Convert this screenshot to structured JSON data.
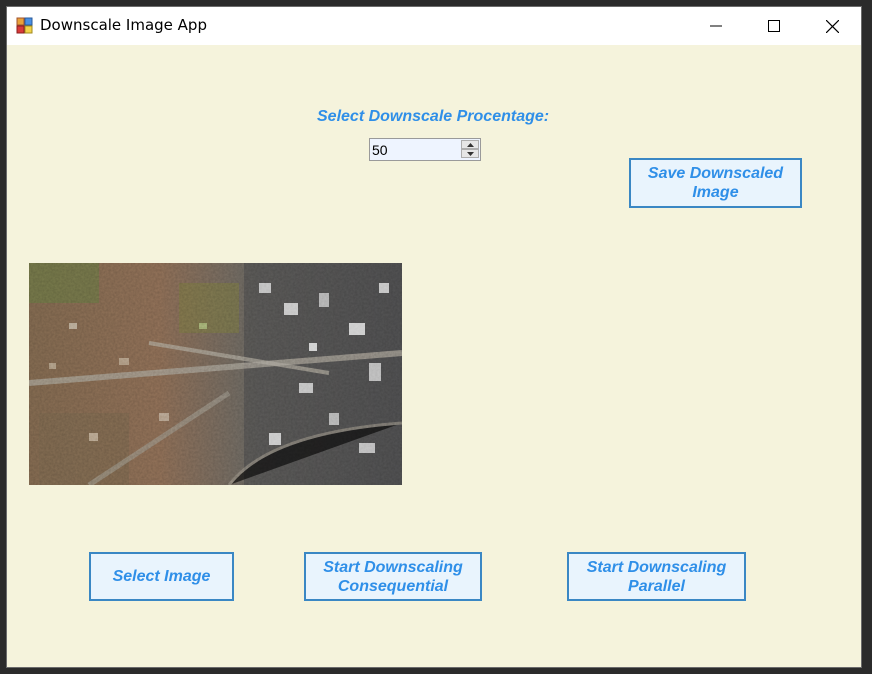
{
  "window": {
    "title": "Downscale Image App",
    "minimize_icon": "minimize-icon",
    "maximize_icon": "maximize-icon",
    "close_icon": "close-icon"
  },
  "downscale": {
    "label": "Select Downscale Procentage:",
    "value": "50"
  },
  "buttons": {
    "save": "Save Downscaled\nImage",
    "select": "Select Image",
    "consequential": "Start Downscaling\nConsequential",
    "parallel": "Start Downscaling\nParallel"
  },
  "colors": {
    "background": "#f5f3dc",
    "accent_text": "#2f8fe8",
    "button_fill": "#e9f4fd",
    "button_border": "#3a87c4"
  }
}
